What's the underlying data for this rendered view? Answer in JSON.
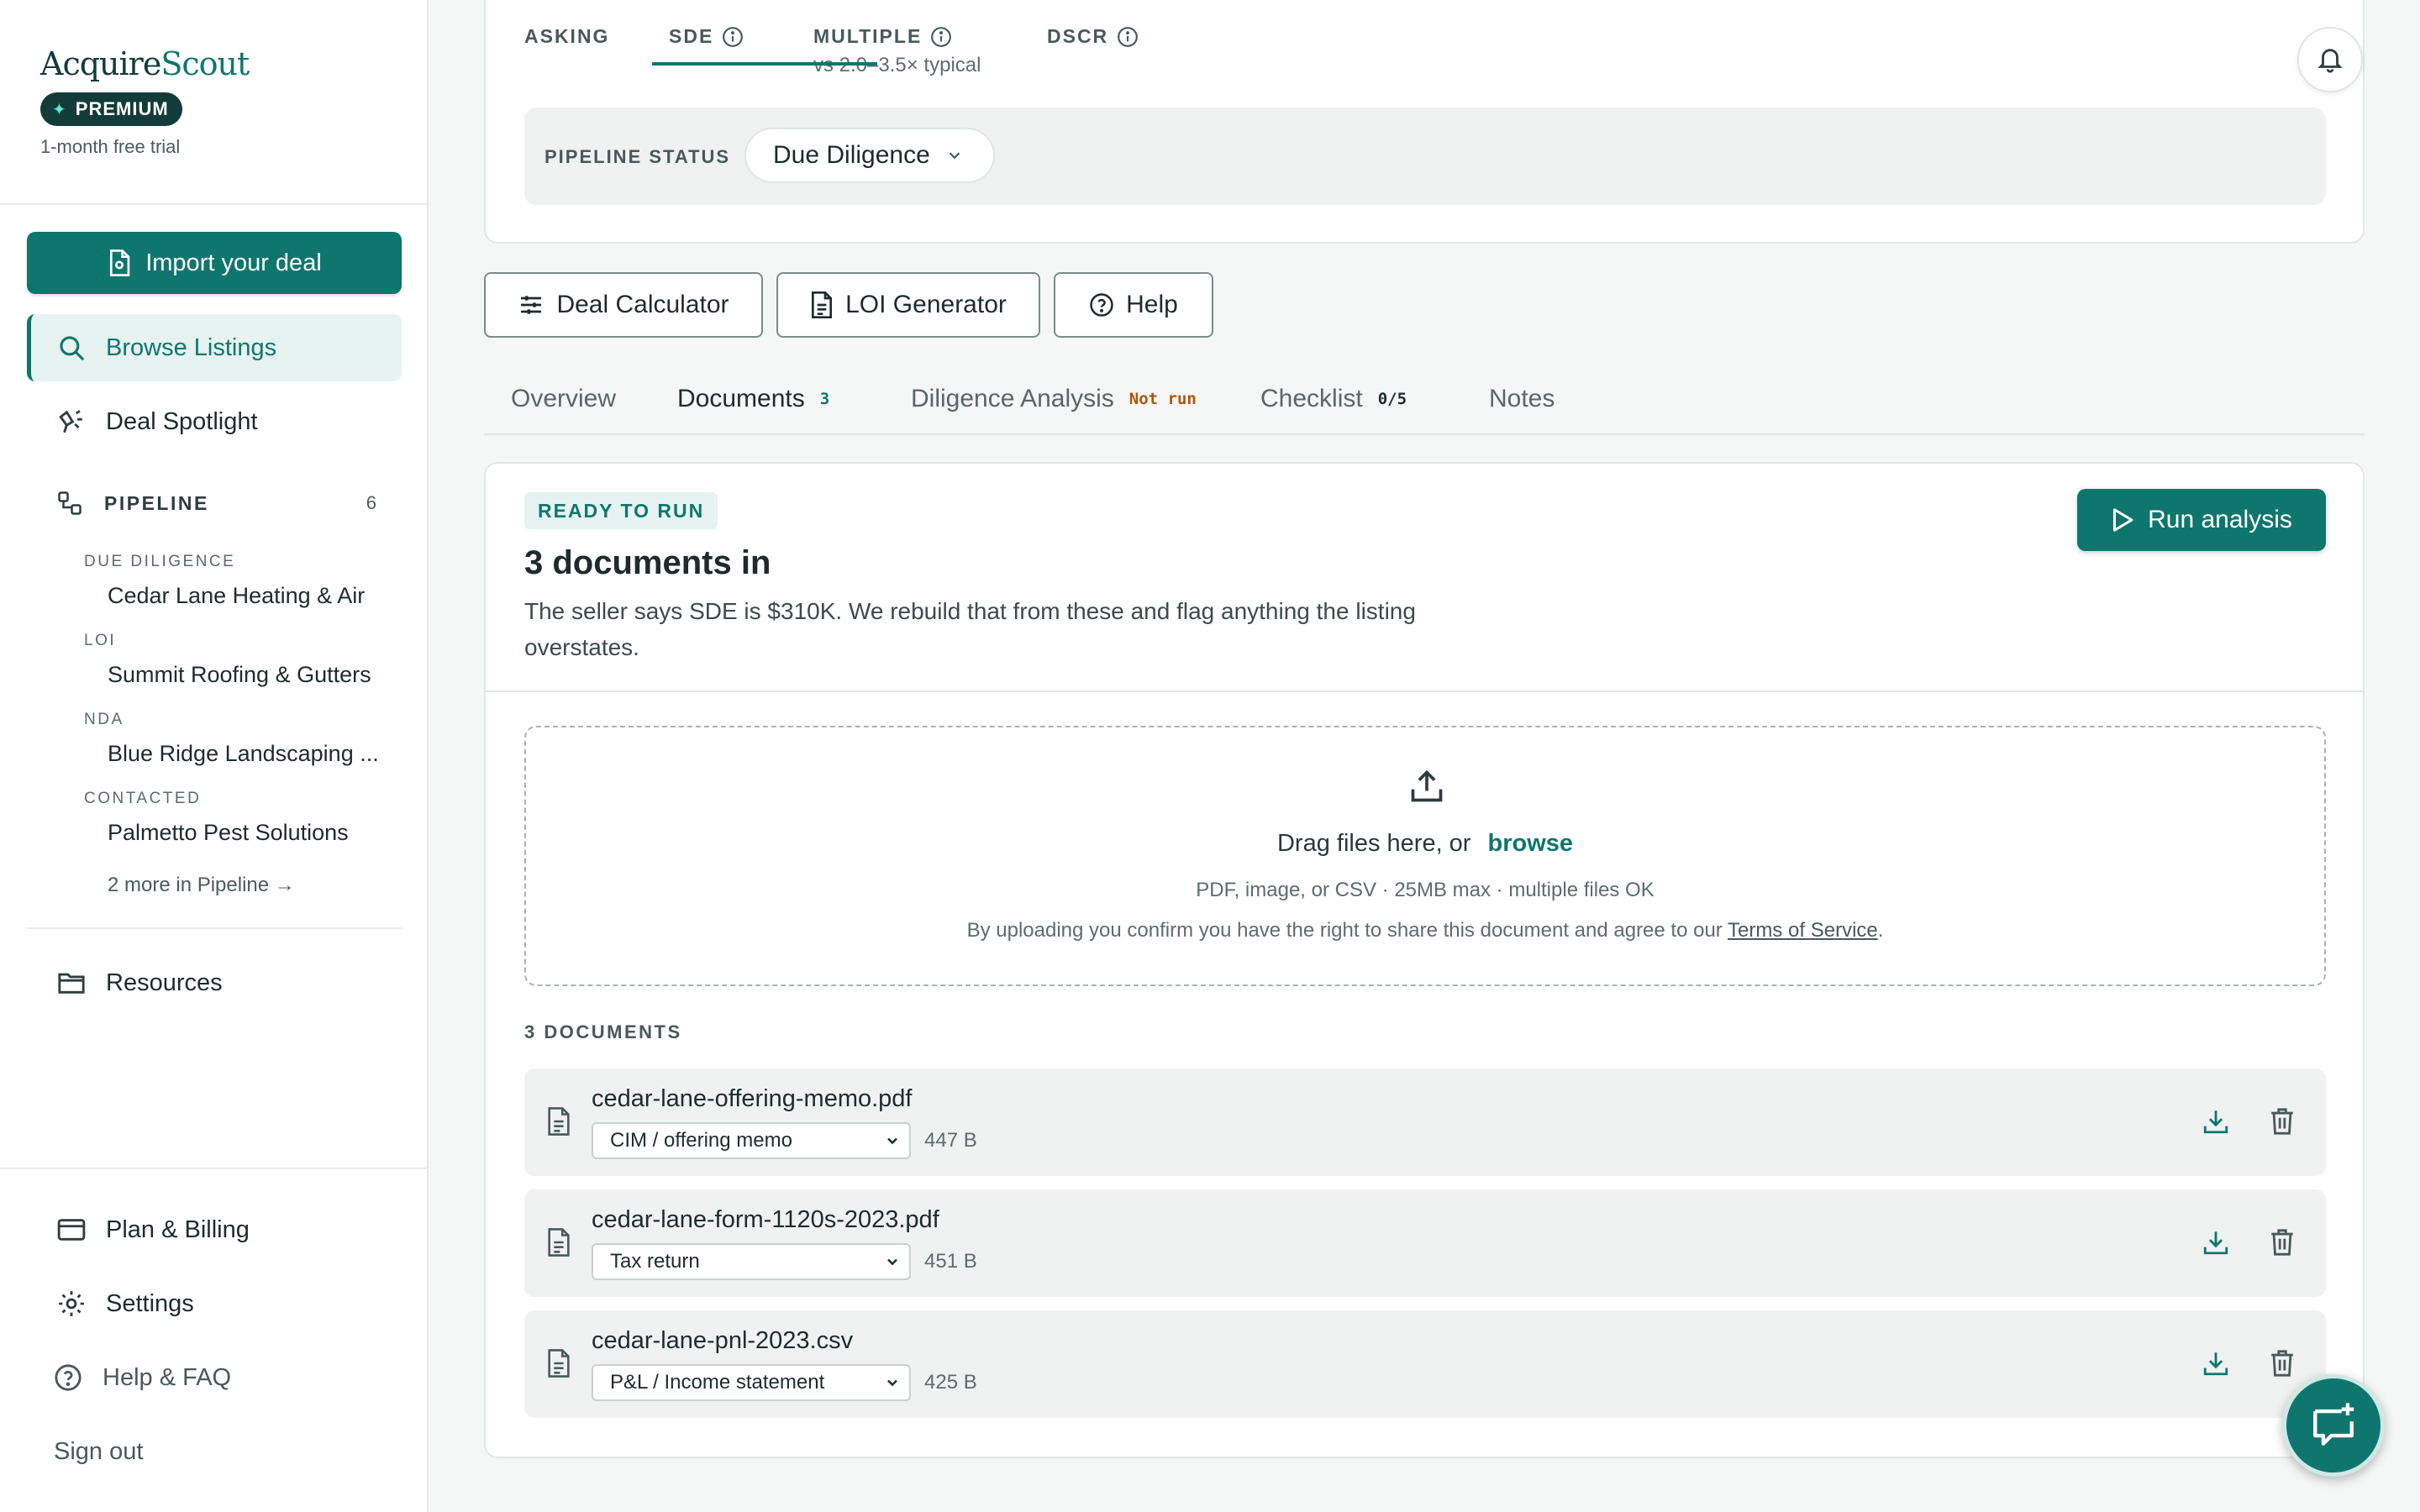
{
  "brand": {
    "name_part1": "Acquire",
    "name_part2": "Scout",
    "badge": "PREMIUM",
    "trial": "1-month free trial"
  },
  "sidebar": {
    "import_label": "Import your deal",
    "nav": [
      {
        "label": "Browse Listings",
        "icon": "search-icon",
        "active": true
      },
      {
        "label": "Deal Spotlight",
        "icon": "spotlight-icon"
      }
    ],
    "pipeline": {
      "label": "PIPELINE",
      "count": "6",
      "deals": [
        {
          "stage": "DUE DILIGENCE",
          "name": "Cedar Lane Heating & Air"
        },
        {
          "stage": "LOI",
          "name": "Summit Roofing & Gutters"
        },
        {
          "stage": "NDA",
          "name": "Blue Ridge Landscaping ..."
        },
        {
          "stage": "CONTACTED",
          "name": "Palmetto Pest Solutions"
        }
      ],
      "more": "2 more in Pipeline →"
    },
    "resources": "Resources",
    "bottom": {
      "billing": "Plan & Billing",
      "settings": "Settings",
      "help": "Help & FAQ",
      "signout": "Sign out"
    }
  },
  "metrics": {
    "asking": "ASKING",
    "sde": "SDE",
    "multiple": "MULTIPLE",
    "multiple_sub": "vs 2.0–3.5× typical",
    "dscr": "DSCR"
  },
  "pipeline_status": {
    "label": "PIPELINE STATUS",
    "value": "Due Diligence"
  },
  "tools": {
    "calculator": "Deal Calculator",
    "loi": "LOI Generator",
    "help": "Help"
  },
  "tabs": {
    "overview": "Overview",
    "documents": "Documents",
    "documents_count": "3",
    "diligence": "Diligence Analysis",
    "diligence_badge": "Not run",
    "checklist": "Checklist",
    "checklist_badge": "0/5",
    "notes": "Notes"
  },
  "documents": {
    "status_badge": "READY TO RUN",
    "title": "3 documents in",
    "description": "The seller says SDE is $310K. We rebuild that from these and flag anything the listing overstates.",
    "run_label": "Run analysis",
    "dropzone": {
      "main": "Drag files here, or",
      "browse": "browse",
      "sub": "PDF, image, or CSV · 25MB max · multiple files OK",
      "legal_prefix": "By uploading you confirm you have the right to share this document and agree to our",
      "legal_link": "Terms of Service",
      "legal_suffix": "."
    },
    "count_label": "3 DOCUMENTS",
    "files": [
      {
        "name": "cedar-lane-offering-memo.pdf",
        "type": "CIM / offering memo",
        "size": "447 B"
      },
      {
        "name": "cedar-lane-form-1120s-2023.pdf",
        "type": "Tax return",
        "size": "451 B"
      },
      {
        "name": "cedar-lane-pnl-2023.csv",
        "type": "P&L / Income statement",
        "size": "425 B"
      }
    ]
  },
  "colors": {
    "accent": "#0f766e",
    "accent_light": "#e6f3f1",
    "dark": "#133b3a",
    "warning": "#b45309"
  }
}
